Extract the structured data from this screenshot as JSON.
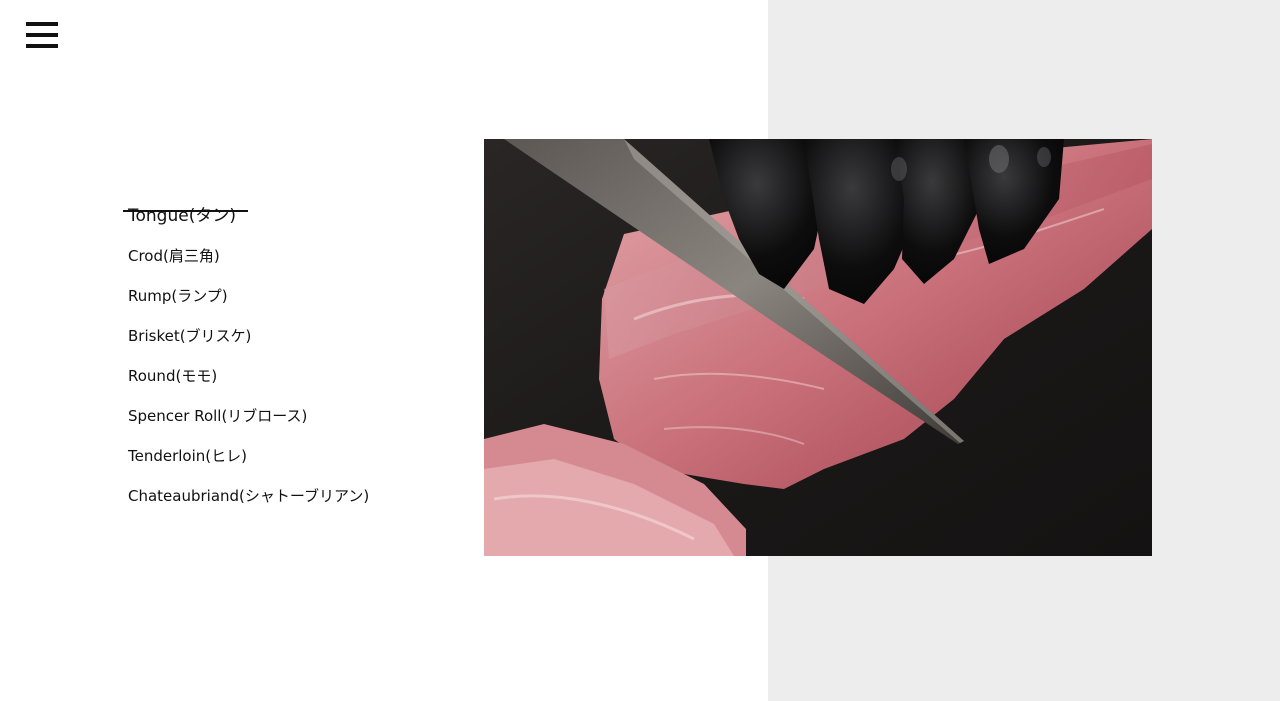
{
  "menu": {
    "icon": "hamburger-menu-icon"
  },
  "cuts": {
    "active_index": 0,
    "items": [
      "Tongue(タン)",
      "Crod(肩三角)",
      "Rump(ランプ)",
      "Brisket(ブリスケ)",
      "Round(モモ)",
      "Spencer Roll(リブロース)",
      "Tenderloin(ヒレ)",
      "Chateaubriand(シャトーブリアン)"
    ]
  },
  "colors": {
    "background": "#ffffff",
    "panel": "#ededed",
    "text": "#111111"
  }
}
